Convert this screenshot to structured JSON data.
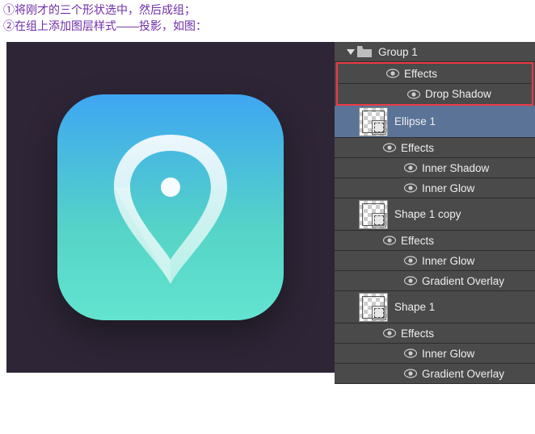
{
  "instructions": {
    "line1": "①将刚才的三个形状选中，然后成组；",
    "line2": "②在组上添加图层样式——投影，如图："
  },
  "layers": {
    "group_name": "Group 1",
    "group_effects_label": "Effects",
    "group_drop_shadow": "Drop Shadow",
    "ellipse1": "Ellipse 1",
    "ellipse1_effects": "Effects",
    "ellipse1_inner_shadow": "Inner Shadow",
    "ellipse1_inner_glow": "Inner Glow",
    "shape1copy": "Shape 1 copy",
    "shape1copy_effects": "Effects",
    "shape1copy_inner_glow": "Inner Glow",
    "shape1copy_gradient_overlay": "Gradient Overlay",
    "shape1": "Shape 1",
    "shape1_effects": "Effects",
    "shape1_inner_glow": "Inner Glow",
    "shape1_gradient_overlay": "Gradient Overlay"
  }
}
